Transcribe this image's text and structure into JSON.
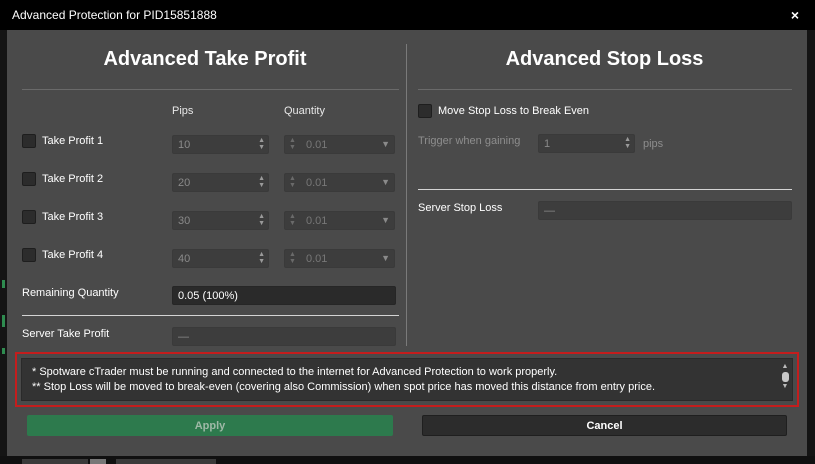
{
  "window": {
    "title": "Advanced Protection for PID15851888",
    "close_glyph": "×"
  },
  "take_profit": {
    "title": "Advanced Take Profit",
    "col_pips": "Pips",
    "col_quantity": "Quantity",
    "rows": [
      {
        "label": "Take Profit 1",
        "pips": "10",
        "quantity": "0.01"
      },
      {
        "label": "Take Profit 2",
        "pips": "20",
        "quantity": "0.01"
      },
      {
        "label": "Take Profit 3",
        "pips": "30",
        "quantity": "0.01"
      },
      {
        "label": "Take Profit 4",
        "pips": "40",
        "quantity": "0.01"
      }
    ],
    "remaining_label": "Remaining Quantity",
    "remaining_value": "0.05 (100%)",
    "server_label": "Server Take Profit",
    "server_value": "—"
  },
  "stop_loss": {
    "title": "Advanced Stop Loss",
    "break_even_label": "Move Stop Loss to Break Even",
    "trigger_label": "Trigger when gaining",
    "trigger_value": "1",
    "trigger_unit": "pips",
    "server_label": "Server Stop Loss",
    "server_value": "—"
  },
  "notes": {
    "line1": "* Spotware cTrader must be running and connected to the internet for Advanced Protection to work properly.",
    "line2": "** Stop Loss will be moved to break-even (covering also Commission) when spot price has moved this distance from entry price."
  },
  "buttons": {
    "apply": "Apply",
    "cancel": "Cancel"
  },
  "colors": {
    "apply_bg": "#2d7a4d",
    "highlight_border": "#c41d1d",
    "dialog_bg": "#4a4a4a"
  }
}
